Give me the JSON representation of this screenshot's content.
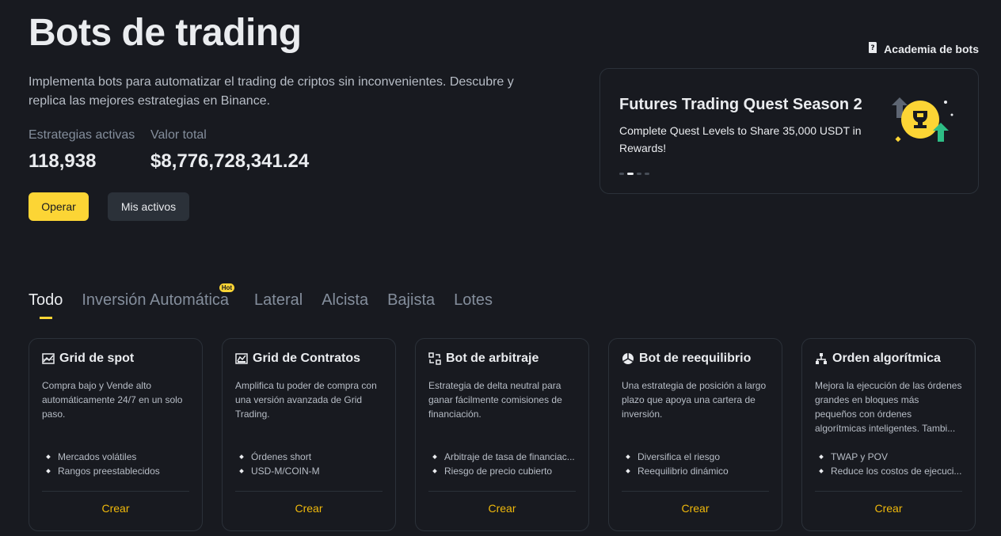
{
  "hero": {
    "title": "Bots de trading",
    "description": "Implementa bots para automatizar el trading de criptos sin inconvenientes. Descubre y replica las mejores estrategias en Binance.",
    "stats": [
      {
        "label": "Estrategias activas",
        "value": "118,938"
      },
      {
        "label": "Valor total",
        "value": "$8,776,728,341.24"
      }
    ],
    "primary_button": "Operar",
    "secondary_button": "Mis activos"
  },
  "academy_link": {
    "label": "Academia de bots",
    "icon": "book-icon"
  },
  "promo": {
    "title": "Futures Trading Quest Season 2",
    "subtitle": "Complete Quest Levels to Share 35,000 USDT in Rewards!",
    "slides": 4,
    "active_slide": 2
  },
  "tabs": [
    {
      "label": "Todo",
      "active": true
    },
    {
      "label": "Inversión Automática",
      "badge": "Hot"
    },
    {
      "label": "Lateral"
    },
    {
      "label": "Alcista"
    },
    {
      "label": "Bajista"
    },
    {
      "label": "Lotes"
    }
  ],
  "cards": [
    {
      "icon": "grid-chart-icon",
      "title": "Grid de spot",
      "description": "Compra bajo y Vende alto automáticamente 24/7 en un solo paso.",
      "bullets": [
        "Mercados volátiles",
        "Rangos preestablecidos"
      ],
      "cta": "Crear"
    },
    {
      "icon": "contract-grid-icon",
      "title": "Grid de Contratos",
      "description": "Amplifica tu poder de compra con una versión avanzada de Grid Trading.",
      "bullets": [
        "Órdenes short",
        "USD-M/COIN-M"
      ],
      "cta": "Crear"
    },
    {
      "icon": "arbitrage-icon",
      "title": "Bot de arbitraje",
      "description": "Estrategia de delta neutral para ganar fácilmente comisiones de financiación.",
      "bullets": [
        "Arbitraje de tasa de financiac...",
        "Riesgo de precio cubierto"
      ],
      "cta": "Crear"
    },
    {
      "icon": "pie-chart-icon",
      "title": "Bot de reequilibrio",
      "description": "Una estrategia de posición a largo plazo que apoya una cartera de inversión.",
      "bullets": [
        "Diversifica el riesgo",
        "Reequilibrio dinámico"
      ],
      "cta": "Crear"
    },
    {
      "icon": "algorithm-icon",
      "title": "Orden algorítmica",
      "description": "Mejora la ejecución de las órdenes grandes en bloques más pequeños con órdenes algorítmicas inteligentes. Tambi...",
      "bullets": [
        "TWAP y POV",
        "Reduce los costos de ejecuci..."
      ],
      "cta": "Crear"
    }
  ],
  "colors": {
    "accent": "#fcd535",
    "background": "#181a20",
    "cta": "#f0b90b"
  }
}
